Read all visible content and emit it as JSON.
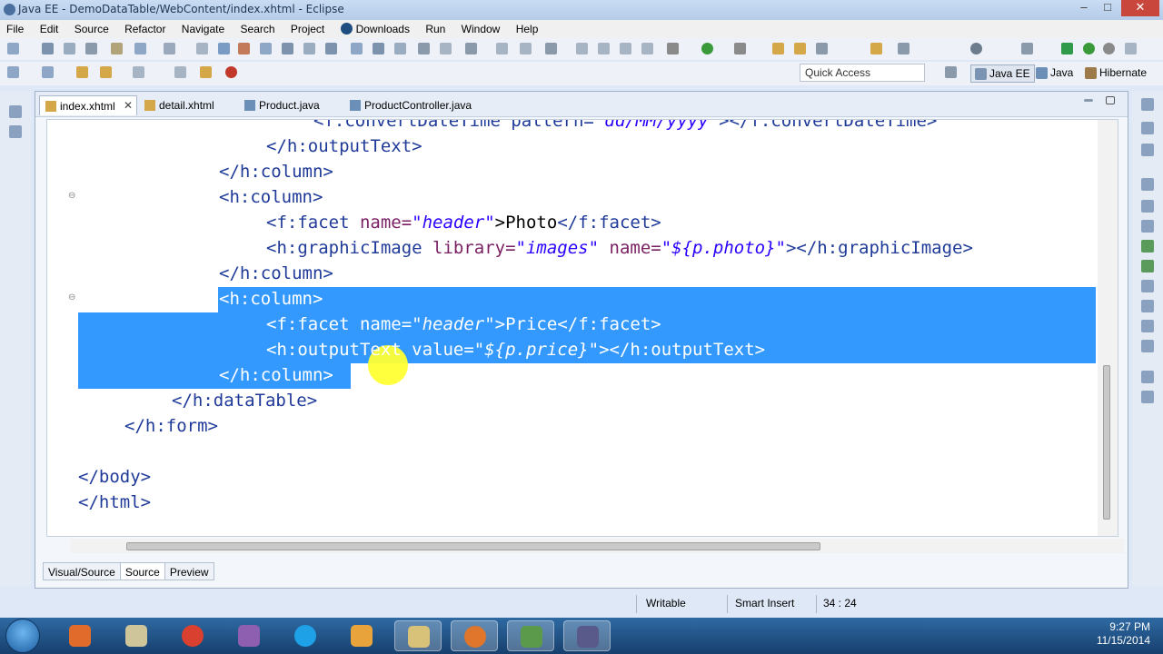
{
  "window": {
    "title": "Java EE - DemoDataTable/WebContent/index.xhtml - Eclipse",
    "minimize": "–",
    "maximize": "□",
    "close": "✕"
  },
  "menu": [
    "File",
    "Edit",
    "Source",
    "Refactor",
    "Navigate",
    "Search",
    "Project",
    "Downloads",
    "Run",
    "Window",
    "Help"
  ],
  "toolbar": {
    "quick_access": "Quick Access",
    "perspectives": [
      "Java EE",
      "Java",
      "Hibernate"
    ]
  },
  "tabs": [
    {
      "label": "index.xhtml",
      "active": true,
      "close": "✕"
    },
    {
      "label": "detail.xhtml",
      "active": false
    },
    {
      "label": "Product.java",
      "active": false
    },
    {
      "label": "ProductController.java",
      "active": false
    }
  ],
  "code": {
    "l0": {
      "tag": "<f:convertDateTime pattern=",
      "value": "\"dd/MM/yyyy\"",
      "rest": "></f:convertDateTime>"
    },
    "l1": "</h:outputText>",
    "l2": "</h:column>",
    "l3": "<h:column>",
    "l4": {
      "open": "<f:facet ",
      "attr": "name=",
      "value": "\"header\"",
      "text": ">Photo",
      "close": "</f:facet>"
    },
    "l5": {
      "open": "<h:graphicImage ",
      "attr1": "library=",
      "value1": "\"images\"",
      "attr2": " name=",
      "value2": "\"${p.photo}\"",
      "close": "></h:graphicImage>"
    },
    "l6": "</h:column>",
    "l7": "<h:column>",
    "l8": {
      "open": "<f:facet ",
      "attr": "name=",
      "value": "\"header\"",
      "text": ">Price",
      "close": "</f:facet>"
    },
    "l9": {
      "open": "<h:outputText ",
      "attr": "value=",
      "value": "\"${p.price}\"",
      "close": "></h:outputText>"
    },
    "l10": "</h:column>",
    "l11": "</h:dataTable>",
    "l12": "</h:form>",
    "l14": "</body>",
    "l15": "</html>"
  },
  "bottom_tabs": [
    "Visual/Source",
    "Source",
    "Preview"
  ],
  "status": {
    "writable": "Writable",
    "insert_mode": "Smart Insert",
    "position": "34 : 24"
  },
  "clock": {
    "time": "9:27 PM",
    "date": "11/15/2014"
  },
  "colors": {
    "selection": "#3399ff",
    "taskbar": "#1f4f82"
  }
}
